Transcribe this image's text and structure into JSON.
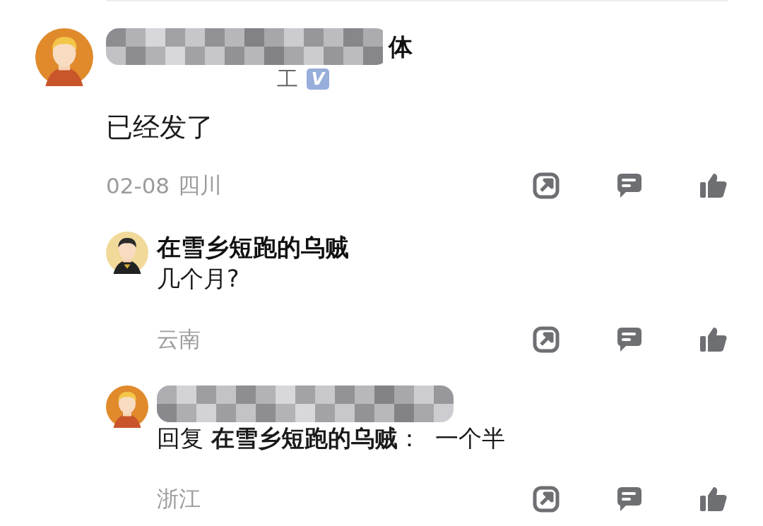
{
  "comment": {
    "redacted": true,
    "name_tail": "体",
    "subtitle_tail": "工",
    "badge": "V",
    "text": "已经发了",
    "date": "02-08",
    "location": "四川"
  },
  "replies": [
    {
      "redacted": false,
      "name": "在雪乡短跑的乌贼",
      "text": "几个月?",
      "location": "云南"
    },
    {
      "redacted": true,
      "text": "回复 **在雪乡短跑的乌贼**：  一个半",
      "location": "浙江"
    }
  ]
}
